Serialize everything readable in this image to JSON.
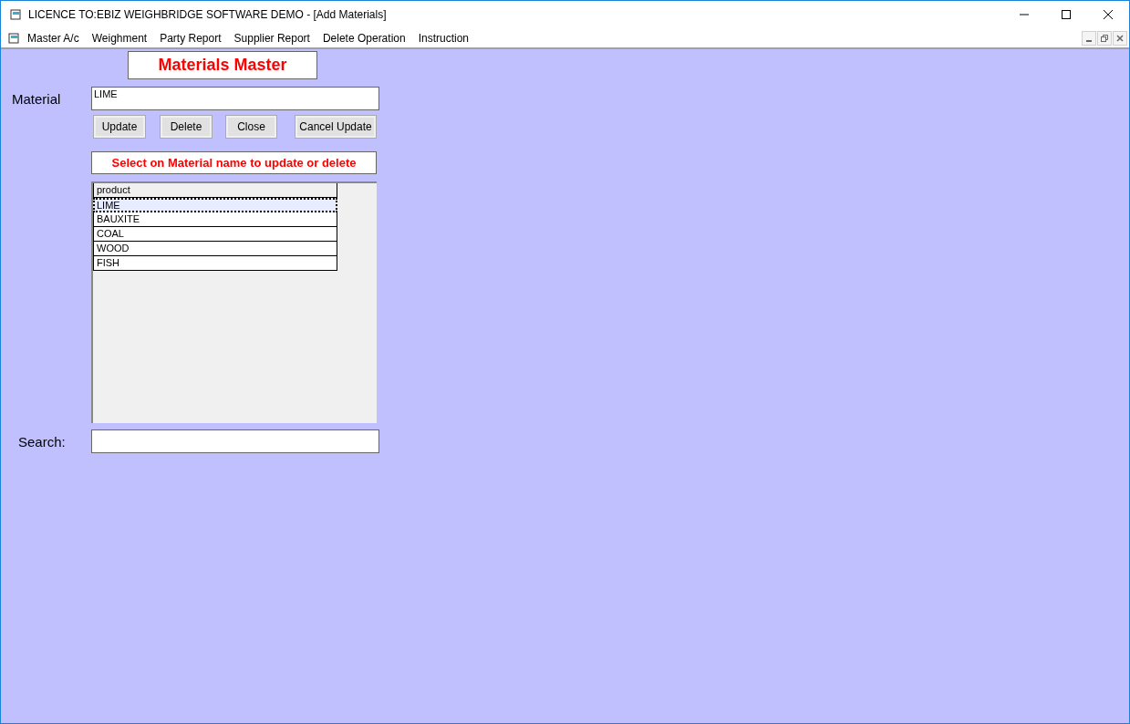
{
  "window": {
    "title": "LICENCE TO:EBIZ WEIGHBRIDGE SOFTWARE DEMO - [Add Materials]"
  },
  "menu": [
    "Master A/c",
    "Weighment",
    "Party Report",
    "Supplier Report",
    "Delete Operation",
    "Instruction"
  ],
  "form": {
    "heading": "Materials Master",
    "material_label": "Material",
    "material_value": "LIME",
    "buttons": [
      "Update",
      "Delete",
      "Close",
      "Cancel Update"
    ],
    "note": "Select on Material name to update or delete",
    "table": {
      "column": "product",
      "rows": [
        {
          "text": "LIME",
          "selected": true
        },
        {
          "text": "BAUXITE",
          "selected": false
        },
        {
          "text": "COAL",
          "selected": false
        },
        {
          "text": "WOOD",
          "selected": false
        },
        {
          "text": "FISH",
          "selected": false
        }
      ]
    },
    "search_label": "Search:"
  }
}
